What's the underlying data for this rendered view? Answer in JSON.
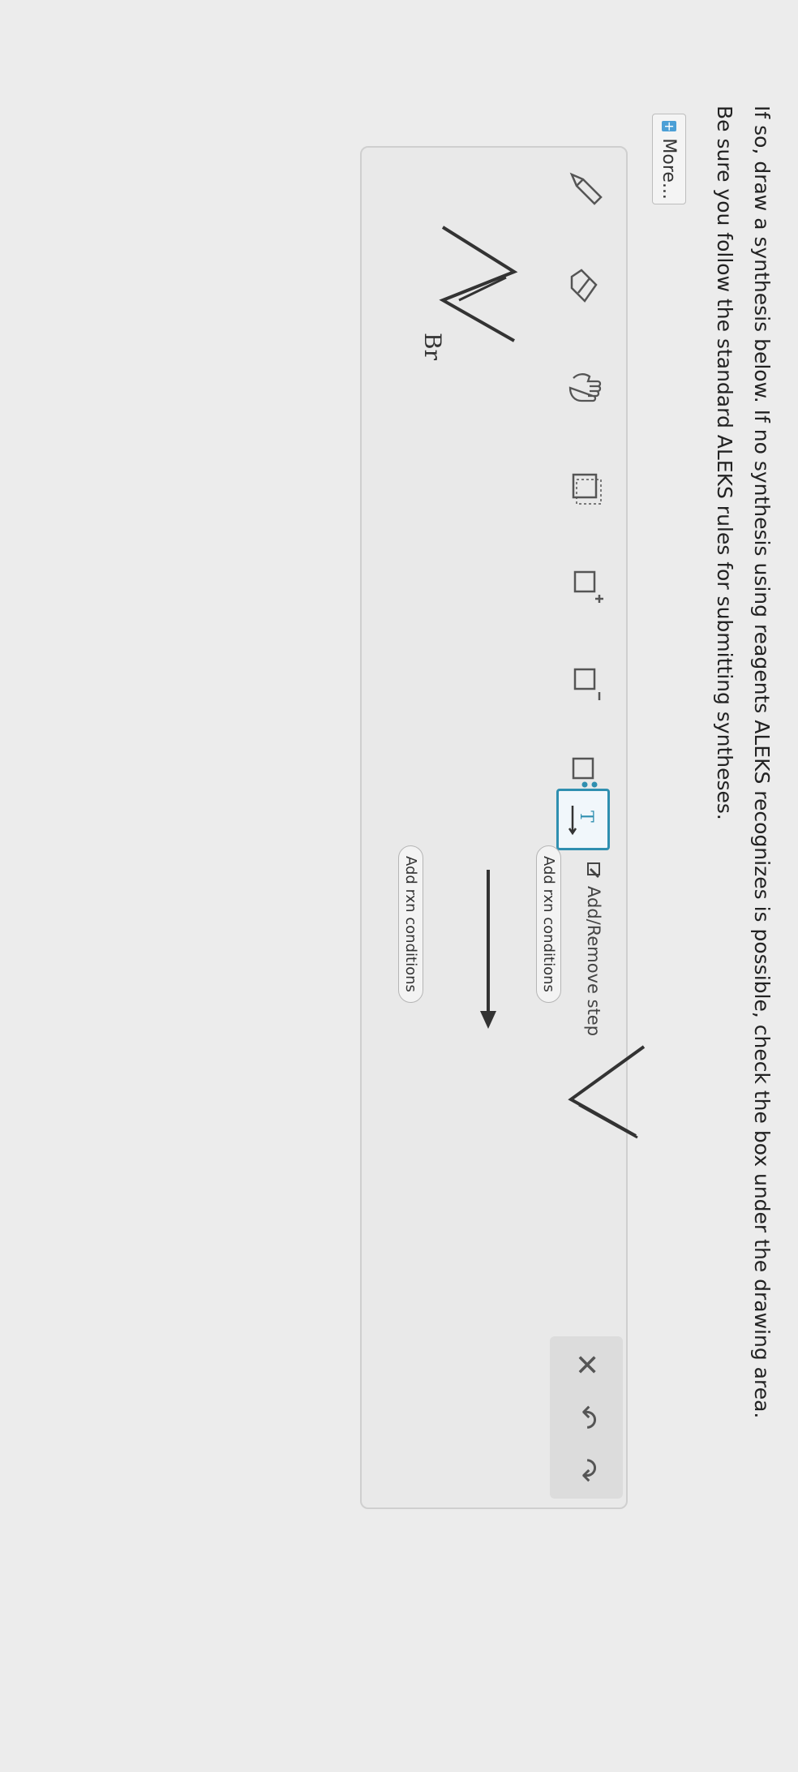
{
  "instructions": {
    "line1": "If so, draw a synthesis below. If no synthesis using reagents ALEKS recognizes is possible, check the box under the drawing area.",
    "line2": "Be sure you follow the standard ALEKS rules for submitting syntheses."
  },
  "more_button": {
    "label": "More..."
  },
  "toolbar": {
    "tools": [
      "pencil-icon",
      "eraser-icon",
      "hand-icon",
      "selection-box-icon",
      "positive-charge-icon",
      "negative-charge-icon",
      "lone-pair-icon",
      "text-tool-icon"
    ],
    "active_tool": "text-tool-icon",
    "right_icons": [
      "close-icon",
      "undo-icon",
      "redo-icon"
    ]
  },
  "step": {
    "add_remove_label": "Add/Remove step"
  },
  "reaction": {
    "conditions_top": "Add rxn conditions",
    "conditions_bottom": "Add rxn conditions",
    "starting_material_atom_label": "Br"
  },
  "colors": {
    "accent": "#2f8fb0",
    "info": "#4b9fd6"
  }
}
